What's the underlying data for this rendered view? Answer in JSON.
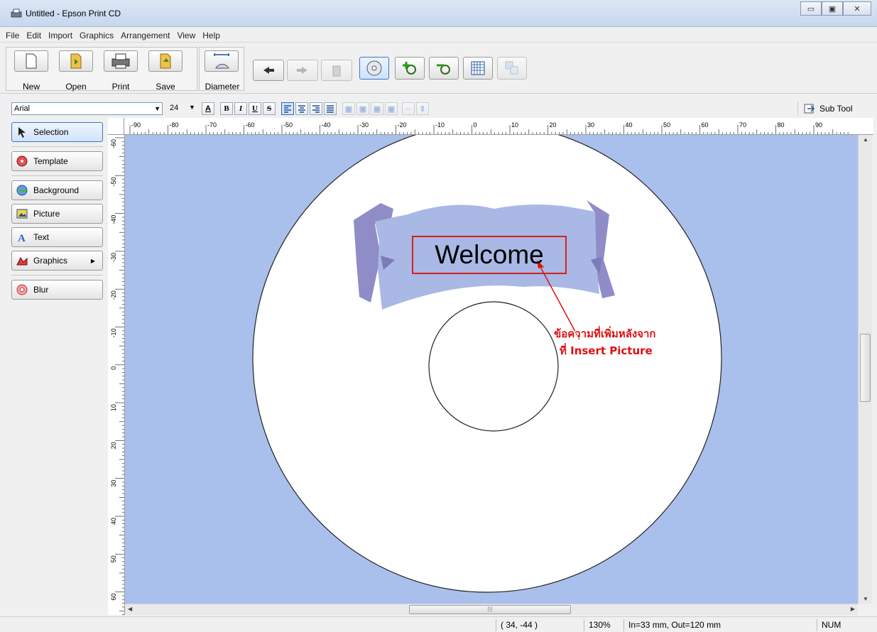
{
  "window": {
    "title": "Untitled - Epson Print CD",
    "controls": [
      "minimize",
      "maximize",
      "close"
    ]
  },
  "menu": [
    "File",
    "Edit",
    "Import",
    "Graphics",
    "Arrangement",
    "View",
    "Help"
  ],
  "toolbar": {
    "new_label": "New",
    "open_label": "Open",
    "print_label": "Print",
    "save_label": "Save",
    "diameter_label": "Diameter"
  },
  "format": {
    "font": "Arial",
    "size": "24",
    "bold": "B",
    "italic": "I",
    "underline": "U",
    "strike": "S",
    "sub_tool_label": "Sub Tool"
  },
  "sidebar": {
    "items": [
      {
        "label": "Selection",
        "icon": "arrow-cursor-icon"
      },
      {
        "label": "Template",
        "icon": "template-icon"
      },
      {
        "label": "Background",
        "icon": "background-icon"
      },
      {
        "label": "Picture",
        "icon": "picture-icon"
      },
      {
        "label": "Text",
        "icon": "text-icon"
      },
      {
        "label": "Graphics",
        "icon": "graphics-icon"
      },
      {
        "label": "Blur",
        "icon": "blur-icon"
      }
    ]
  },
  "ruler": {
    "h_labels": [
      "-90",
      "-80",
      "-70",
      "-60",
      "-50",
      "-40",
      "-30",
      "-20",
      "-10",
      "0",
      "10",
      "20",
      "30",
      "40",
      "50",
      "60",
      "70",
      "80",
      "90"
    ],
    "v_labels": [
      "-60",
      "-50",
      "-40",
      "-30",
      "-20",
      "-10",
      "0",
      "10",
      "20",
      "30",
      "40",
      "50",
      "60"
    ]
  },
  "canvas": {
    "welcome_text": "Welcome",
    "annotation_line1": "ข้อความที่เพิ่มหลังจาก",
    "annotation_line2": "ที่ Insert Picture",
    "colors": {
      "background": "#aac0ec",
      "banner": "#a9b8e4",
      "banner_dark": "#8f8cc8",
      "annotation": "#e01010"
    }
  },
  "status": {
    "coords": "( 34, -44 )",
    "zoom": "130%",
    "disc": "In=33 mm, Out=120 mm",
    "num": "NUM"
  }
}
